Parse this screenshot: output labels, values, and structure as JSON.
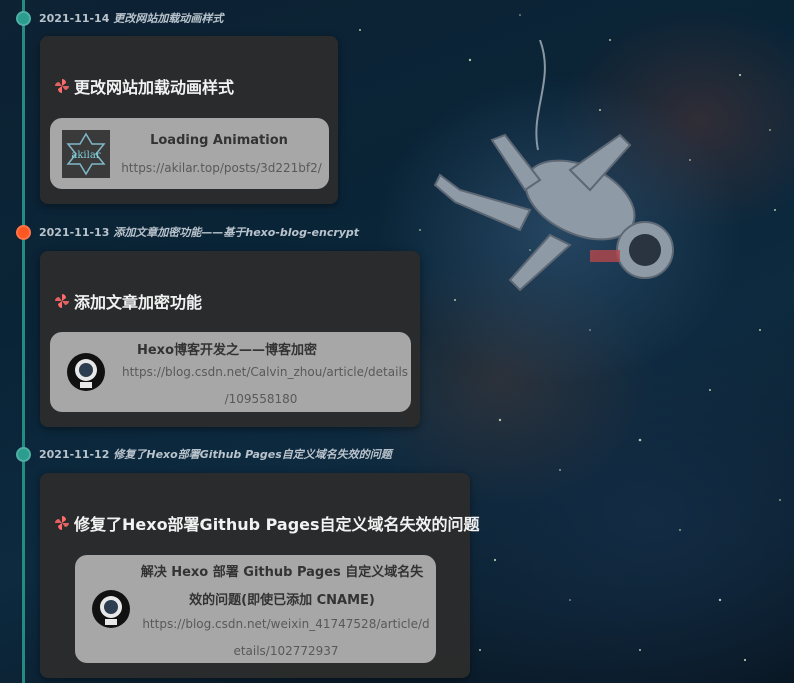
{
  "colors": {
    "timeline": "#2a9d8f",
    "dot_active": "#ff5722",
    "card_bg": "#2c2c2c",
    "link_card_bg": "#a7a7a7"
  },
  "entries": [
    {
      "date": "2021-11-14",
      "desc": "更改网站加载动画样式",
      "title": "更改网站加载动画样式",
      "link": {
        "title": "Loading Animation",
        "url": "https://akilar.top/posts/3d221bf2/",
        "thumb": "akilar-logo-icon"
      }
    },
    {
      "date": "2021-11-13",
      "desc": "添加文章加密功能——基于hexo-blog-encrypt",
      "title": "添加文章加密功能",
      "link": {
        "title": "Hexo博客开发之——博客加密",
        "url_lines": [
          "https://blog.csdn.net/Calvin_zhou/article/details",
          "/109558180"
        ],
        "thumb": "astronaut-avatar-icon"
      }
    },
    {
      "date": "2021-11-12",
      "desc": "修复了Hexo部署Github Pages自定义域名失效的问题",
      "title": "修复了Hexo部署Github Pages自定义域名失效的问题",
      "link": {
        "title_lines": [
          "解决 Hexo 部署 Github Pages 自定义域名失",
          "效的问题(即使已添加 CNAME)"
        ],
        "url_lines": [
          "https://blog.csdn.net/weixin_41747528/article/d",
          "etails/102772937"
        ],
        "thumb": "astronaut-avatar-icon"
      }
    }
  ]
}
